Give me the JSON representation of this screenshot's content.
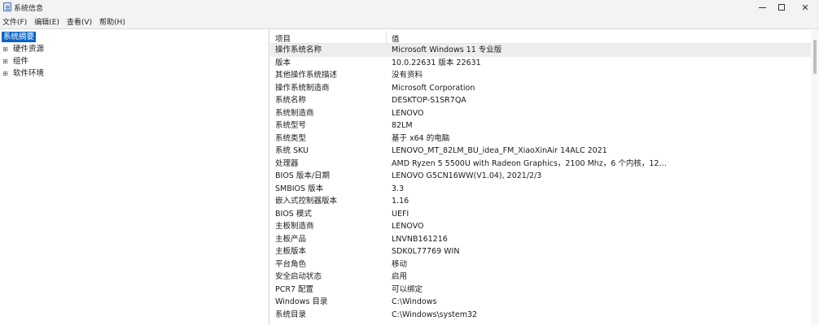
{
  "window": {
    "title": "系统信息",
    "controls": {
      "minimize": "—",
      "maximize": "□",
      "close": "✕"
    }
  },
  "menu": [
    "文件(F)",
    "编辑(E)",
    "查看(V)",
    "帮助(H)"
  ],
  "tree": [
    {
      "label": "系统摘要",
      "selected": true,
      "expander": ""
    },
    {
      "label": "硬件资源",
      "selected": false,
      "expander": "⊞"
    },
    {
      "label": "组件",
      "selected": false,
      "expander": "⊞"
    },
    {
      "label": "软件环境",
      "selected": false,
      "expander": "⊞"
    }
  ],
  "list": {
    "columns": {
      "item": "项目",
      "value": "值"
    },
    "rows": [
      {
        "item": "操作系统名称",
        "value": "Microsoft Windows 11 专业版"
      },
      {
        "item": "版本",
        "value": "10.0.22631 版本 22631"
      },
      {
        "item": "其他操作系统描述",
        "value": "没有资料"
      },
      {
        "item": "操作系统制造商",
        "value": "Microsoft Corporation"
      },
      {
        "item": "系统名称",
        "value": "DESKTOP-S1SR7QA"
      },
      {
        "item": "系统制造商",
        "value": "LENOVO"
      },
      {
        "item": "系统型号",
        "value": "82LM"
      },
      {
        "item": "系统类型",
        "value": "基于 x64 的电脑"
      },
      {
        "item": "系统 SKU",
        "value": "LENOVO_MT_82LM_BU_idea_FM_XiaoXinAir 14ALC 2021"
      },
      {
        "item": "处理器",
        "value": "AMD Ryzen 5 5500U with Radeon Graphics，2100 Mhz，6 个内核，12…"
      },
      {
        "item": "BIOS 版本/日期",
        "value": "LENOVO G5CN16WW(V1.04), 2021/2/3"
      },
      {
        "item": "SMBIOS 版本",
        "value": "3.3"
      },
      {
        "item": "嵌入式控制器版本",
        "value": "1.16"
      },
      {
        "item": "BIOS 模式",
        "value": "UEFI"
      },
      {
        "item": "主板制造商",
        "value": "LENOVO"
      },
      {
        "item": "主板产品",
        "value": "LNVNB161216"
      },
      {
        "item": "主板版本",
        "value": "SDK0L77769 WIN"
      },
      {
        "item": "平台角色",
        "value": "移动"
      },
      {
        "item": "安全启动状态",
        "value": "启用"
      },
      {
        "item": "PCR7 配置",
        "value": "可以绑定"
      },
      {
        "item": "Windows 目录",
        "value": "C:\\Windows"
      },
      {
        "item": "系统目录",
        "value": "C:\\Windows\\system32"
      }
    ],
    "highlighted_row": 0
  }
}
